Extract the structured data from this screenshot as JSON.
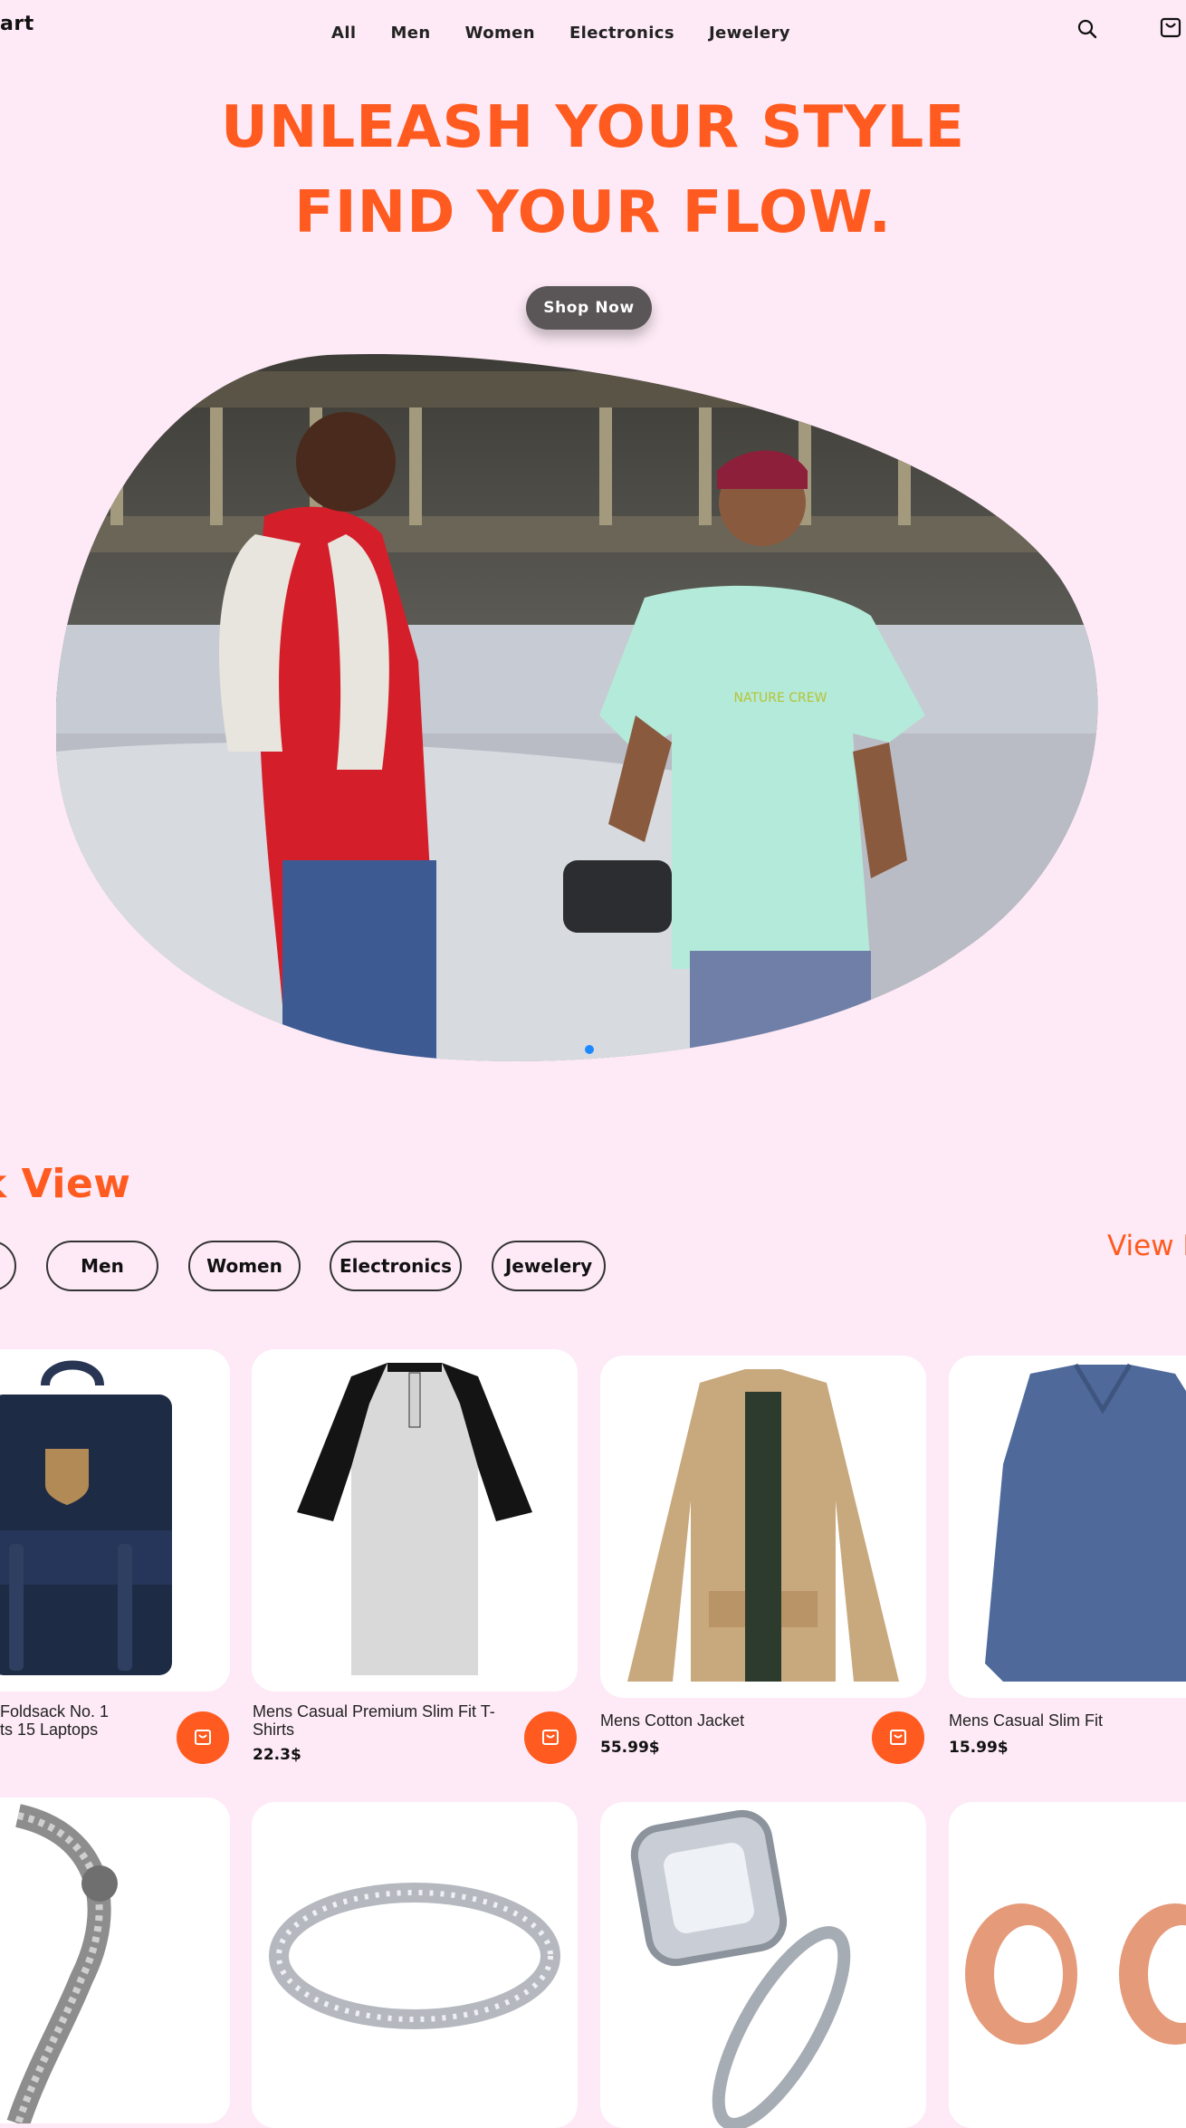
{
  "header": {
    "logo_text": "art",
    "nav": [
      "All",
      "Men",
      "Women",
      "Electronics",
      "Jewelery"
    ],
    "icons": [
      "search-icon",
      "cart-icon"
    ]
  },
  "hero": {
    "line1": "UNLEASH YOUR STYLE",
    "line2": "FIND YOUR FLOW.",
    "cta": "Shop Now",
    "image": "two-men-streetwear-photo"
  },
  "quick_view": {
    "title": "k View",
    "view_more": "View M",
    "filters": [
      "",
      "Men",
      "Women",
      "Electronics",
      "Jewelery"
    ]
  },
  "products_row1": [
    {
      "title_line1": "Foldsack No. 1",
      "title_line2": "ts 15 Laptops",
      "price": "",
      "image": "backpack"
    },
    {
      "title_line1": "Mens Casual Premium Slim Fit T-",
      "title_line2": "Shirts",
      "price": "22.3$",
      "image": "raglan-tshirt"
    },
    {
      "title_line1": "Mens Cotton Jacket",
      "title_line2": "",
      "price": "55.99$",
      "image": "cotton-jacket"
    },
    {
      "title_line1": "Mens Casual Slim Fit",
      "title_line2": "",
      "price": "15.99$",
      "image": "slim-fit-shirt"
    }
  ],
  "products_row2": [
    {
      "image": "dragon-bracelet"
    },
    {
      "image": "silver-band-ring"
    },
    {
      "image": "diamond-ring-set"
    },
    {
      "image": "rose-gold-plugs"
    }
  ],
  "colors": {
    "background": "#fdeaf6",
    "accent": "#ff5a1f",
    "button_dark": "#5a5556",
    "dot": "#1e88ff"
  }
}
